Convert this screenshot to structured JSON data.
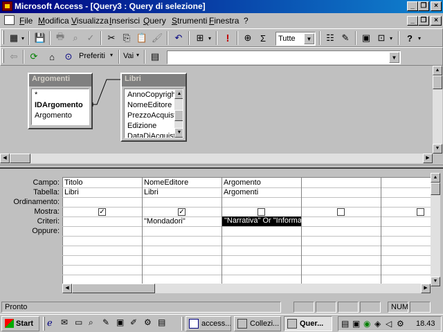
{
  "window": {
    "title": "Microsoft Access - [Query3 : Query di selezione]"
  },
  "menu": {
    "items": [
      "File",
      "Modifica",
      "Visualizza",
      "Inserisci",
      "Query",
      "Strumenti",
      "Finestra",
      "?"
    ]
  },
  "toolbar": {
    "top_values": "Tutte"
  },
  "web_toolbar": {
    "favorites": "Preferiti",
    "go": "Vai",
    "address": ""
  },
  "tables": [
    {
      "name": "Argomenti",
      "fields": [
        "*",
        "IDArgomento",
        "Argomento"
      ],
      "bold_field": "IDArgomento"
    },
    {
      "name": "Libri",
      "fields": [
        "AnnoCopyright",
        "NomeEditore",
        "PrezzoAcquisto",
        "Edizione",
        "DataDiAcquisto"
      ]
    }
  ],
  "grid": {
    "row_labels": [
      "Campo:",
      "Tabella:",
      "Ordinamento:",
      "Mostra:",
      "Criteri:",
      "Oppure:"
    ],
    "columns": [
      {
        "field": "Titolo",
        "table": "Libri",
        "sort": "",
        "show": true,
        "criteria": ""
      },
      {
        "field": "NomeEditore",
        "table": "Libri",
        "sort": "",
        "show": true,
        "criteria": "\"Mondadori\""
      },
      {
        "field": "Argomento",
        "table": "Argomenti",
        "sort": "",
        "show": false,
        "criteria": "\"Narrativa\" Or \"Informa"
      },
      {
        "field": "",
        "table": "",
        "sort": "",
        "show": false,
        "criteria": ""
      },
      {
        "field": "",
        "table": "",
        "sort": "",
        "show": false,
        "criteria": ""
      }
    ]
  },
  "status": {
    "text": "Pronto",
    "num": "NUM"
  },
  "taskbar": {
    "start": "Start",
    "buttons": [
      "access...",
      "Collezi...",
      "Quer..."
    ],
    "clock": "18.43"
  }
}
